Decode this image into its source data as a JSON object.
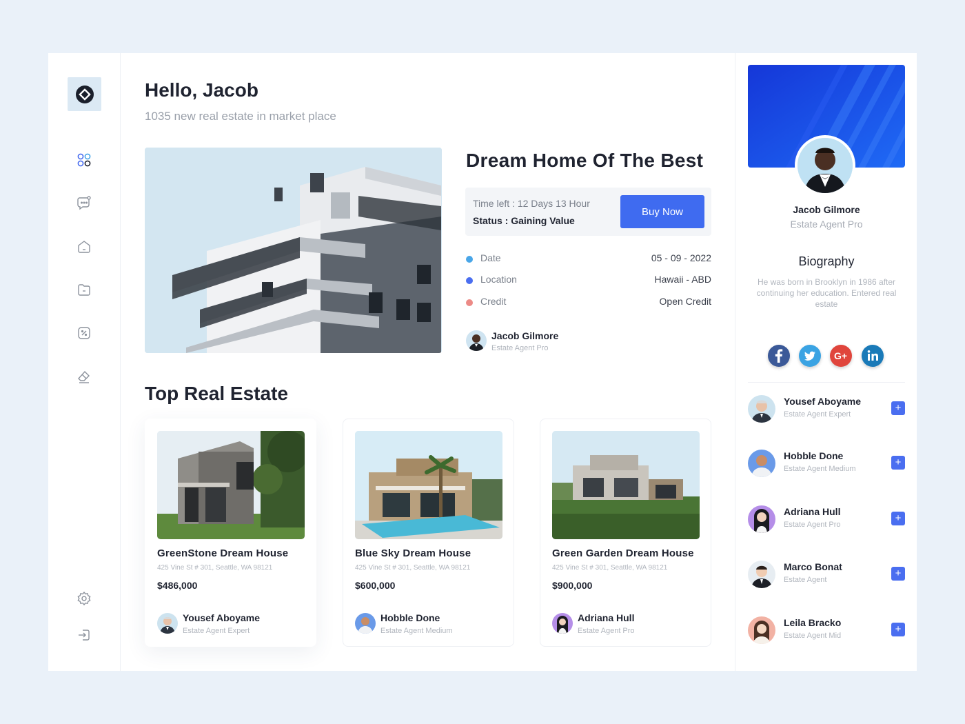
{
  "greeting": "Hello, Jacob",
  "subtitle": "1035 new real estate in market place",
  "featured": {
    "title": "Dream Home Of The Best",
    "time_left": "Time left : 12 Days 13 Hour",
    "status": "Status : Gaining Value",
    "buy_label": "Buy Now",
    "details": [
      {
        "label": "Date",
        "value": "05 - 09 - 2022",
        "color": "#49a6e8"
      },
      {
        "label": "Location",
        "value": "Hawaii - ABD",
        "color": "#4a6ef0"
      },
      {
        "label": "Credit",
        "value": "Open Credit",
        "color": "#ec8a86"
      }
    ],
    "agent": {
      "name": "Jacob Gilmore",
      "role": "Estate Agent Pro"
    }
  },
  "top_section_title": "Top Real Estate",
  "listings": [
    {
      "title": "GreenStone Dream House",
      "address": "425 Vine St # 301, Seattle, WA 98121",
      "price": "$486,000",
      "agent": {
        "name": "Yousef Aboyame",
        "role": "Estate Agent Expert"
      }
    },
    {
      "title": "Blue Sky Dream House",
      "address": "425 Vine St # 301, Seattle, WA 98121",
      "price": "$600,000",
      "agent": {
        "name": "Hobble Done",
        "role": "Estate Agent Medium"
      }
    },
    {
      "title": "Green Garden Dream House",
      "address": "425 Vine St # 301, Seattle, WA 98121",
      "price": "$900,000",
      "agent": {
        "name": "Adriana Hull",
        "role": "Estate Agent Pro"
      }
    }
  ],
  "profile": {
    "name": "Jacob Gilmore",
    "role": "Estate Agent Pro",
    "bio_title": "Biography",
    "bio": "He was born in Brooklyn in 1986 after continuing her education. Entered real estate",
    "social": [
      "facebook-icon",
      "twitter-icon",
      "google-plus-icon",
      "linkedin-icon"
    ]
  },
  "agents": [
    {
      "name": "Yousef Aboyame",
      "role": "Estate Agent Expert",
      "add": "+"
    },
    {
      "name": "Hobble Done",
      "role": "Estate Agent Medium",
      "add": "+"
    },
    {
      "name": "Adriana Hull",
      "role": "Estate Agent Pro",
      "add": "+"
    },
    {
      "name": "Marco Bonat",
      "role": "Estate Agent",
      "add": "+"
    },
    {
      "name": "Leila Bracko",
      "role": "Estate Agent Mid",
      "add": "+"
    }
  ],
  "sidebar_icons": [
    "dashboard-icon",
    "messages-icon",
    "home-icon",
    "folder-icon",
    "discount-icon",
    "eraser-icon",
    "settings-icon",
    "logout-icon"
  ],
  "colors": {
    "accent": "#3f6bf0",
    "background": "#eaf1f9",
    "logo_bg": "#dbe9f4"
  }
}
